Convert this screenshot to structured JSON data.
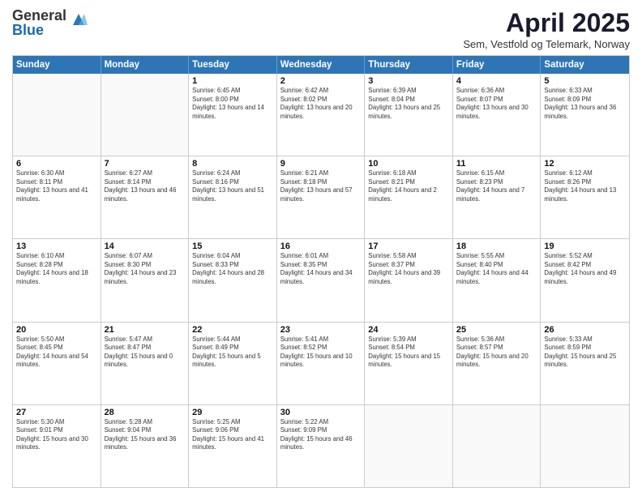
{
  "logo": {
    "general": "General",
    "blue": "Blue"
  },
  "header": {
    "title": "April 2025",
    "subtitle": "Sem, Vestfold og Telemark, Norway"
  },
  "days": [
    "Sunday",
    "Monday",
    "Tuesday",
    "Wednesday",
    "Thursday",
    "Friday",
    "Saturday"
  ],
  "weeks": [
    [
      {
        "num": "",
        "text": ""
      },
      {
        "num": "",
        "text": ""
      },
      {
        "num": "1",
        "text": "Sunrise: 6:45 AM\nSunset: 8:00 PM\nDaylight: 13 hours and 14 minutes."
      },
      {
        "num": "2",
        "text": "Sunrise: 6:42 AM\nSunset: 8:02 PM\nDaylight: 13 hours and 20 minutes."
      },
      {
        "num": "3",
        "text": "Sunrise: 6:39 AM\nSunset: 8:04 PM\nDaylight: 13 hours and 25 minutes."
      },
      {
        "num": "4",
        "text": "Sunrise: 6:36 AM\nSunset: 8:07 PM\nDaylight: 13 hours and 30 minutes."
      },
      {
        "num": "5",
        "text": "Sunrise: 6:33 AM\nSunset: 8:09 PM\nDaylight: 13 hours and 36 minutes."
      }
    ],
    [
      {
        "num": "6",
        "text": "Sunrise: 6:30 AM\nSunset: 8:11 PM\nDaylight: 13 hours and 41 minutes."
      },
      {
        "num": "7",
        "text": "Sunrise: 6:27 AM\nSunset: 8:14 PM\nDaylight: 13 hours and 46 minutes."
      },
      {
        "num": "8",
        "text": "Sunrise: 6:24 AM\nSunset: 8:16 PM\nDaylight: 13 hours and 51 minutes."
      },
      {
        "num": "9",
        "text": "Sunrise: 6:21 AM\nSunset: 8:18 PM\nDaylight: 13 hours and 57 minutes."
      },
      {
        "num": "10",
        "text": "Sunrise: 6:18 AM\nSunset: 8:21 PM\nDaylight: 14 hours and 2 minutes."
      },
      {
        "num": "11",
        "text": "Sunrise: 6:15 AM\nSunset: 8:23 PM\nDaylight: 14 hours and 7 minutes."
      },
      {
        "num": "12",
        "text": "Sunrise: 6:12 AM\nSunset: 8:26 PM\nDaylight: 14 hours and 13 minutes."
      }
    ],
    [
      {
        "num": "13",
        "text": "Sunrise: 6:10 AM\nSunset: 8:28 PM\nDaylight: 14 hours and 18 minutes."
      },
      {
        "num": "14",
        "text": "Sunrise: 6:07 AM\nSunset: 8:30 PM\nDaylight: 14 hours and 23 minutes."
      },
      {
        "num": "15",
        "text": "Sunrise: 6:04 AM\nSunset: 8:33 PM\nDaylight: 14 hours and 28 minutes."
      },
      {
        "num": "16",
        "text": "Sunrise: 6:01 AM\nSunset: 8:35 PM\nDaylight: 14 hours and 34 minutes."
      },
      {
        "num": "17",
        "text": "Sunrise: 5:58 AM\nSunset: 8:37 PM\nDaylight: 14 hours and 39 minutes."
      },
      {
        "num": "18",
        "text": "Sunrise: 5:55 AM\nSunset: 8:40 PM\nDaylight: 14 hours and 44 minutes."
      },
      {
        "num": "19",
        "text": "Sunrise: 5:52 AM\nSunset: 8:42 PM\nDaylight: 14 hours and 49 minutes."
      }
    ],
    [
      {
        "num": "20",
        "text": "Sunrise: 5:50 AM\nSunset: 8:45 PM\nDaylight: 14 hours and 54 minutes."
      },
      {
        "num": "21",
        "text": "Sunrise: 5:47 AM\nSunset: 8:47 PM\nDaylight: 15 hours and 0 minutes."
      },
      {
        "num": "22",
        "text": "Sunrise: 5:44 AM\nSunset: 8:49 PM\nDaylight: 15 hours and 5 minutes."
      },
      {
        "num": "23",
        "text": "Sunrise: 5:41 AM\nSunset: 8:52 PM\nDaylight: 15 hours and 10 minutes."
      },
      {
        "num": "24",
        "text": "Sunrise: 5:39 AM\nSunset: 8:54 PM\nDaylight: 15 hours and 15 minutes."
      },
      {
        "num": "25",
        "text": "Sunrise: 5:36 AM\nSunset: 8:57 PM\nDaylight: 15 hours and 20 minutes."
      },
      {
        "num": "26",
        "text": "Sunrise: 5:33 AM\nSunset: 8:59 PM\nDaylight: 15 hours and 25 minutes."
      }
    ],
    [
      {
        "num": "27",
        "text": "Sunrise: 5:30 AM\nSunset: 9:01 PM\nDaylight: 15 hours and 30 minutes."
      },
      {
        "num": "28",
        "text": "Sunrise: 5:28 AM\nSunset: 9:04 PM\nDaylight: 15 hours and 36 minutes."
      },
      {
        "num": "29",
        "text": "Sunrise: 5:25 AM\nSunset: 9:06 PM\nDaylight: 15 hours and 41 minutes."
      },
      {
        "num": "30",
        "text": "Sunrise: 5:22 AM\nSunset: 9:09 PM\nDaylight: 15 hours and 46 minutes."
      },
      {
        "num": "",
        "text": ""
      },
      {
        "num": "",
        "text": ""
      },
      {
        "num": "",
        "text": ""
      }
    ]
  ]
}
